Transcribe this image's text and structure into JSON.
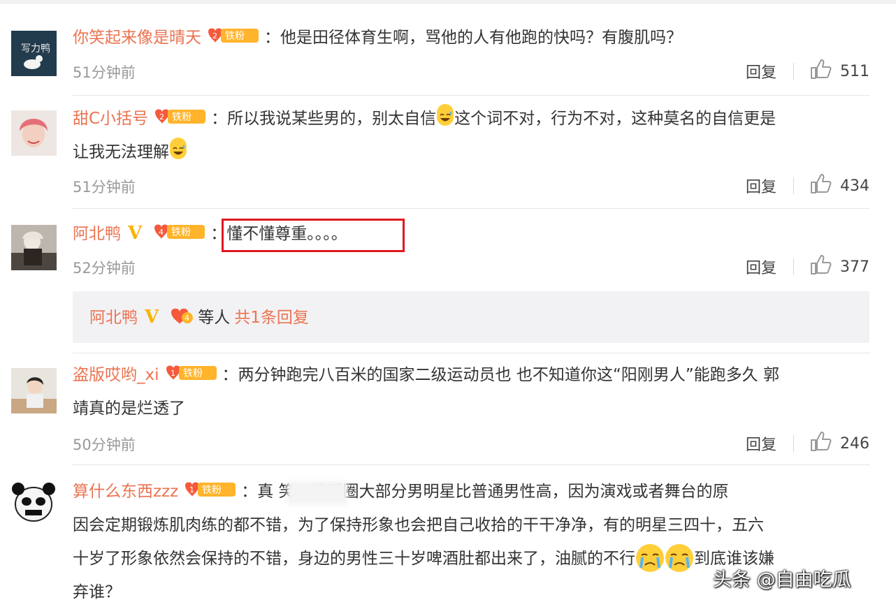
{
  "comments": [
    {
      "user": "你笑起来像是晴天",
      "badge_level": "2",
      "badge_text": "铁粉",
      "text": "：他是田径体育生啊，骂他的人有他跑的快吗？有腹肌吗？",
      "time": "51分钟前",
      "reply_label": "回复",
      "likes": "511"
    },
    {
      "user": "甜C小括号",
      "badge_level": "2",
      "badge_text": "铁粉",
      "text_a": "：所以我说某些男的，别太自信",
      "text_b": "这个词不对，行为不对，这种莫名的自信更是",
      "text_c": "让我无法理解",
      "emoji": "grin-sweat-icon",
      "time": "51分钟前",
      "reply_label": "回复",
      "likes": "434"
    },
    {
      "user": "阿北鸭",
      "verified": "V",
      "badge_level": "4",
      "badge_text": "铁粉",
      "text": "：懂不懂尊重。。。。",
      "time": "52分钟前",
      "reply_label": "回复",
      "likes": "377",
      "sub_reply": {
        "user": "阿北鸭",
        "verified": "V",
        "badge_level": "4",
        "middle": "等人",
        "tail": "共1条回复"
      }
    },
    {
      "user": "盗版哎哟_xi",
      "badge_level": "1",
      "badge_text": "铁粉",
      "text": "：两分钟跑完八百米的国家二级运动员也 也不知道你这“阳刚男人”能跑多久 郭",
      "text2": "靖真的是烂透了",
      "time": "50分钟前",
      "reply_label": "回复",
      "likes": "246"
    },
    {
      "user": "算什么东西zzz",
      "badge_level": "1",
      "badge_text": "铁粉",
      "text1": "：真 笑。娱乐圈大部分男明星比普通男性高，因为演戏或者舞台的原",
      "text2": "因会定期锻炼肌肉练的都不错，为了保持形象也会把自己收拾的干干净净，有的明星三四十，五六",
      "text3a": "十岁了形象依然会保持的不错，身边的男性三十岁啤酒肚都出来了，油腻的不行",
      "text3b": "到底谁该嫌",
      "text4": "弃谁？",
      "emoji": "crying-icon"
    }
  ],
  "watermark": "头条 @自由吃瓜",
  "colors": {
    "username": "#eb7350",
    "badge": "#f7b500",
    "highlight_box": "#e0181e",
    "icon": "#999999"
  }
}
